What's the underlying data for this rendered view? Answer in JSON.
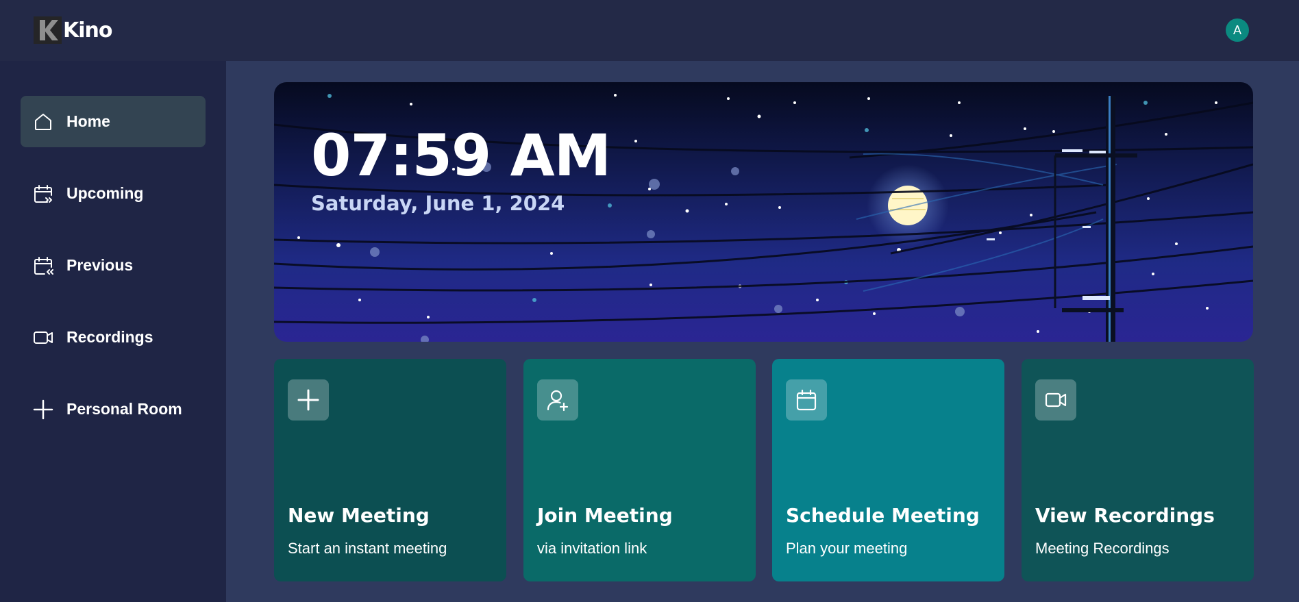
{
  "app": {
    "name": "Kino",
    "logo_letter": "K"
  },
  "user": {
    "avatar_initial": "A",
    "avatar_color": "#0b8a80"
  },
  "sidebar": {
    "items": [
      {
        "label": "Home",
        "icon": "home-icon",
        "active": true
      },
      {
        "label": "Upcoming",
        "icon": "calendar-forward-icon",
        "active": false
      },
      {
        "label": "Previous",
        "icon": "calendar-back-icon",
        "active": false
      },
      {
        "label": "Recordings",
        "icon": "video-icon",
        "active": false
      },
      {
        "label": "Personal Room",
        "icon": "plus-icon",
        "active": false
      }
    ]
  },
  "hero": {
    "time": "07:59 AM",
    "date": "Saturday, June 1, 2024"
  },
  "cards": [
    {
      "title": "New Meeting",
      "subtitle": "Start an instant meeting",
      "icon": "plus-icon",
      "color": "#0c4f52"
    },
    {
      "title": "Join Meeting",
      "subtitle": "via invitation link",
      "icon": "user-add-icon",
      "color": "#0a6a68"
    },
    {
      "title": "Schedule Meeting",
      "subtitle": "Plan your meeting",
      "icon": "calendar-icon",
      "color": "#07818c"
    },
    {
      "title": "View Recordings",
      "subtitle": "Meeting Recordings",
      "icon": "video-icon",
      "color": "#0f5457"
    }
  ]
}
